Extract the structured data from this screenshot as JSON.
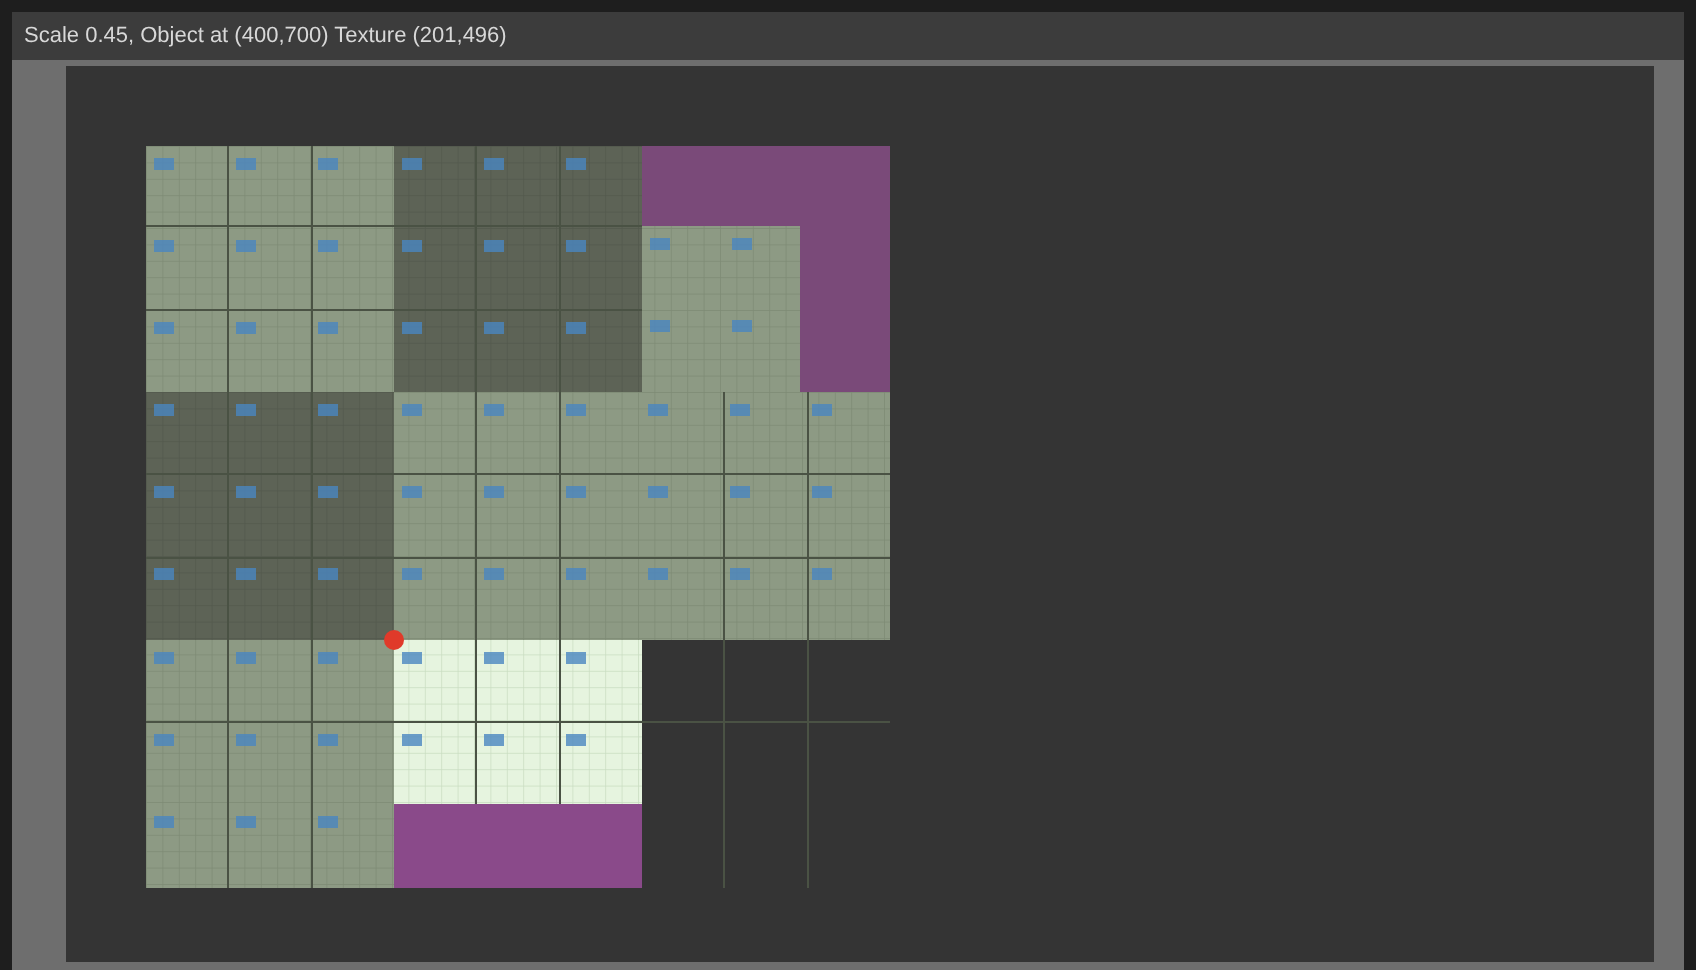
{
  "window": {
    "title": "Scale 0.45, Object at (400,700) Texture (201,496)"
  }
}
